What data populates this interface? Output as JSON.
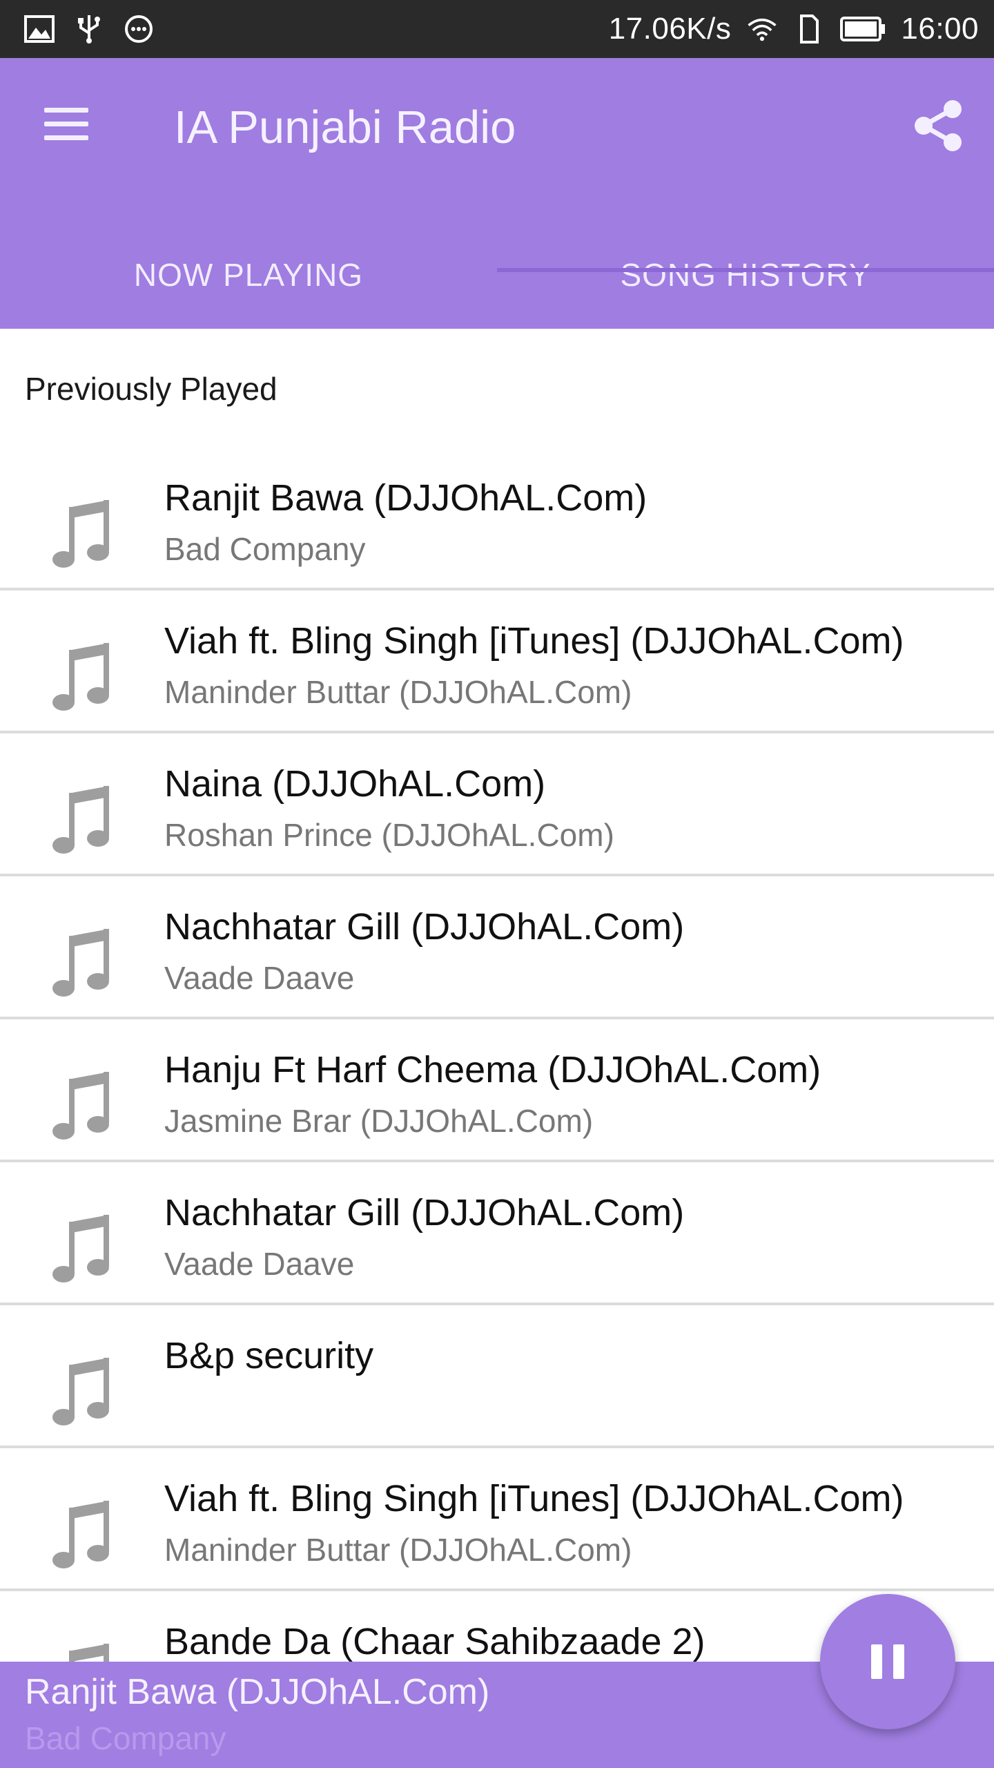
{
  "status_bar": {
    "speed": "17.06K/s",
    "time": "16:00",
    "icons": [
      "image-icon",
      "usb-icon",
      "chat-bubble-icon",
      "wifi-icon",
      "sim-icon",
      "battery-icon"
    ]
  },
  "app_bar": {
    "title": "IA Punjabi Radio",
    "menu_icon": "menu-icon",
    "share_icon": "share-icon"
  },
  "tabs": [
    {
      "label": "NOW PLAYING",
      "selected": false
    },
    {
      "label": "SONG HISTORY",
      "selected": true
    }
  ],
  "section": {
    "header": "Previously Played"
  },
  "history": [
    {
      "title": "Ranjit Bawa (DJJOhAL.Com)",
      "subtitle": "Bad Company"
    },
    {
      "title": "Viah ft. Bling Singh [iTunes] (DJJOhAL.Com)",
      "subtitle": "Maninder Buttar (DJJOhAL.Com)"
    },
    {
      "title": "Naina (DJJOhAL.Com)",
      "subtitle": "Roshan Prince (DJJOhAL.Com)"
    },
    {
      "title": "Nachhatar Gill (DJJOhAL.Com)",
      "subtitle": "Vaade Daave"
    },
    {
      "title": "Hanju Ft Harf Cheema (DJJOhAL.Com)",
      "subtitle": "Jasmine Brar (DJJOhAL.Com)"
    },
    {
      "title": "Nachhatar Gill (DJJOhAL.Com)",
      "subtitle": "Vaade Daave"
    },
    {
      "title": "B&p security",
      "subtitle": ""
    },
    {
      "title": "Viah ft. Bling Singh [iTunes] (DJJOhAL.Com)",
      "subtitle": "Maninder Buttar (DJJOhAL.Com)"
    },
    {
      "title": "Bande Da (Chaar Sahibzaade 2)",
      "subtitle": ""
    }
  ],
  "player": {
    "title": "Ranjit Bawa (DJJOhAL.Com)",
    "subtitle": "Bad Company",
    "control_icon": "pause-icon"
  },
  "colors": {
    "primary": "#9f7de1",
    "tab_indicator": "#8b68d6",
    "status_bar": "#2a2a2a",
    "note_icon": "#9e9e9e"
  }
}
